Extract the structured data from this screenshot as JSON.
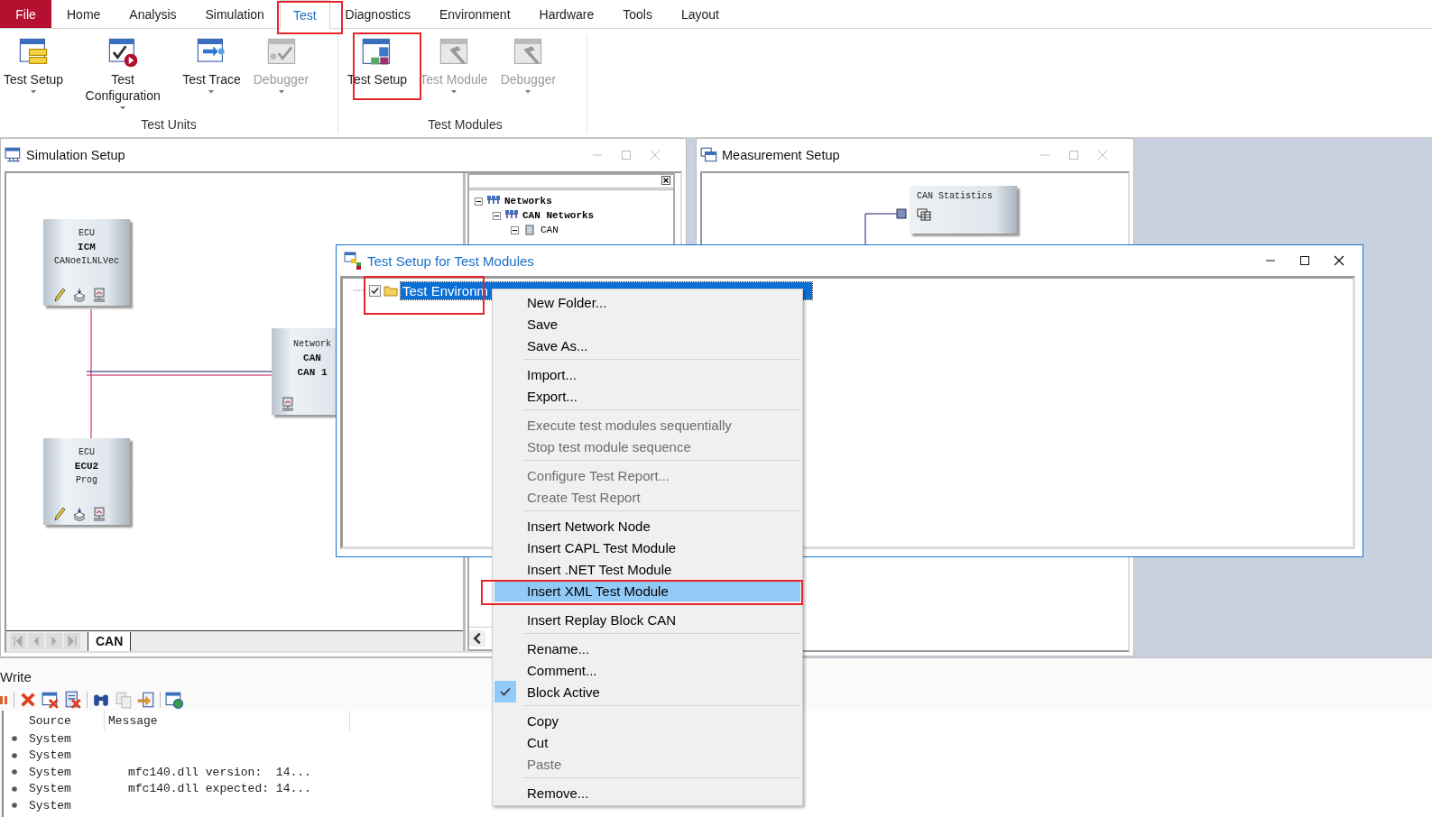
{
  "menu_tabs": [
    {
      "label": "File",
      "kind": "file",
      "selected": false,
      "annotated": false
    },
    {
      "label": "Home",
      "kind": "tab",
      "selected": false,
      "annotated": false
    },
    {
      "label": "Analysis",
      "kind": "tab",
      "selected": false,
      "annotated": false
    },
    {
      "label": "Simulation",
      "kind": "tab",
      "selected": false,
      "annotated": false
    },
    {
      "label": "Test",
      "kind": "tab",
      "selected": true,
      "annotated": true
    },
    {
      "label": "Diagnostics",
      "kind": "tab",
      "selected": false,
      "annotated": false
    },
    {
      "label": "Environment",
      "kind": "tab",
      "selected": false,
      "annotated": false
    },
    {
      "label": "Hardware",
      "kind": "tab",
      "selected": false,
      "annotated": false
    },
    {
      "label": "Tools",
      "kind": "tab",
      "selected": false,
      "annotated": false
    },
    {
      "label": "Layout",
      "kind": "tab",
      "selected": false,
      "annotated": false
    }
  ],
  "ribbon": {
    "groups": [
      {
        "title": "Test Units",
        "buttons": [
          {
            "label": "Test Setup",
            "dropdown": true,
            "disabled": false,
            "annotated": false
          },
          {
            "label": "Test Configuration",
            "dropdown": true,
            "disabled": false,
            "annotated": false
          },
          {
            "label": "Test Trace",
            "dropdown": true,
            "disabled": false,
            "annotated": false
          },
          {
            "label": "Debugger",
            "dropdown": true,
            "disabled": true,
            "annotated": false
          }
        ]
      },
      {
        "title": "Test Modules",
        "buttons": [
          {
            "label": "Test Setup",
            "dropdown": false,
            "disabled": false,
            "annotated": true
          },
          {
            "label": "Test Module",
            "dropdown": true,
            "disabled": true,
            "annotated": false
          },
          {
            "label": "Debugger",
            "dropdown": true,
            "disabled": true,
            "annotated": false
          }
        ]
      }
    ]
  },
  "simulation_setup": {
    "title": "Simulation Setup",
    "ecus": [
      {
        "type": "ECU",
        "name": "ICM",
        "detail": "CANoeILNLVec"
      },
      {
        "type": "ECU",
        "name": "ECU2",
        "detail": "Prog"
      }
    ],
    "network": {
      "type": "Network",
      "bus": "CAN",
      "name": "CAN 1"
    },
    "bus_tabs": [
      {
        "label": "CAN",
        "selected": true
      }
    ],
    "tree": [
      {
        "label": "Networks",
        "expanded": true,
        "children": [
          {
            "label": "CAN Networks",
            "expanded": true,
            "children": [
              {
                "label": "CAN",
                "expanded": true
              }
            ]
          }
        ]
      }
    ]
  },
  "measurement_setup": {
    "title": "Measurement Setup",
    "block": {
      "label": "CAN Statistics"
    }
  },
  "test_setup_dialog": {
    "title": "Test Setup for Test Modules",
    "tree": [
      {
        "label": "Test Environm",
        "checked": true,
        "selected": true,
        "annotated": true
      }
    ]
  },
  "context_menu": {
    "sections": [
      [
        {
          "label": "New Folder...",
          "disabled": false,
          "checked": false,
          "highlighted": false,
          "annotated": false
        },
        {
          "label": "Save",
          "disabled": false,
          "checked": false,
          "highlighted": false,
          "annotated": false
        },
        {
          "label": "Save As...",
          "disabled": false,
          "checked": false,
          "highlighted": false,
          "annotated": false
        }
      ],
      [
        {
          "label": "Import...",
          "disabled": false,
          "checked": false,
          "highlighted": false,
          "annotated": false
        },
        {
          "label": "Export...",
          "disabled": false,
          "checked": false,
          "highlighted": false,
          "annotated": false
        }
      ],
      [
        {
          "label": "Execute test modules sequentially",
          "disabled": true,
          "checked": false,
          "highlighted": false,
          "annotated": false
        },
        {
          "label": "Stop test module sequence",
          "disabled": true,
          "checked": false,
          "highlighted": false,
          "annotated": false
        }
      ],
      [
        {
          "label": "Configure Test Report...",
          "disabled": true,
          "checked": false,
          "highlighted": false,
          "annotated": false
        },
        {
          "label": "Create Test Report",
          "disabled": true,
          "checked": false,
          "highlighted": false,
          "annotated": false
        }
      ],
      [
        {
          "label": "Insert Network Node",
          "disabled": false,
          "checked": false,
          "highlighted": false,
          "annotated": false
        },
        {
          "label": "Insert CAPL Test Module",
          "disabled": false,
          "checked": false,
          "highlighted": false,
          "annotated": false
        },
        {
          "label": "Insert .NET Test Module",
          "disabled": false,
          "checked": false,
          "highlighted": false,
          "annotated": false
        },
        {
          "label": "Insert XML Test Module",
          "disabled": false,
          "checked": false,
          "highlighted": true,
          "annotated": true
        }
      ],
      [
        {
          "label": "Insert Replay Block CAN",
          "disabled": false,
          "checked": false,
          "highlighted": false,
          "annotated": false
        }
      ],
      [
        {
          "label": "Rename...",
          "disabled": false,
          "checked": false,
          "highlighted": false,
          "annotated": false
        },
        {
          "label": "Comment...",
          "disabled": false,
          "checked": false,
          "highlighted": false,
          "annotated": false
        },
        {
          "label": "Block Active",
          "disabled": false,
          "checked": true,
          "highlighted": false,
          "annotated": false
        }
      ],
      [
        {
          "label": "Copy",
          "disabled": false,
          "checked": false,
          "highlighted": false,
          "annotated": false
        },
        {
          "label": "Cut",
          "disabled": false,
          "checked": false,
          "highlighted": false,
          "annotated": false
        },
        {
          "label": "Paste",
          "disabled": true,
          "checked": false,
          "highlighted": false,
          "annotated": false
        }
      ],
      [
        {
          "label": "Remove...",
          "disabled": false,
          "checked": false,
          "highlighted": false,
          "annotated": false
        }
      ]
    ]
  },
  "write_panel": {
    "title": "Write",
    "columns": [
      "Source",
      "Message"
    ],
    "rows": [
      {
        "source": "System"
      },
      {
        "source": "System"
      },
      {
        "source": "System",
        "message": "mfc140.dll version:  14..."
      },
      {
        "source": "System",
        "message": "mfc140.dll expected: 14..."
      },
      {
        "source": "System"
      }
    ]
  }
}
